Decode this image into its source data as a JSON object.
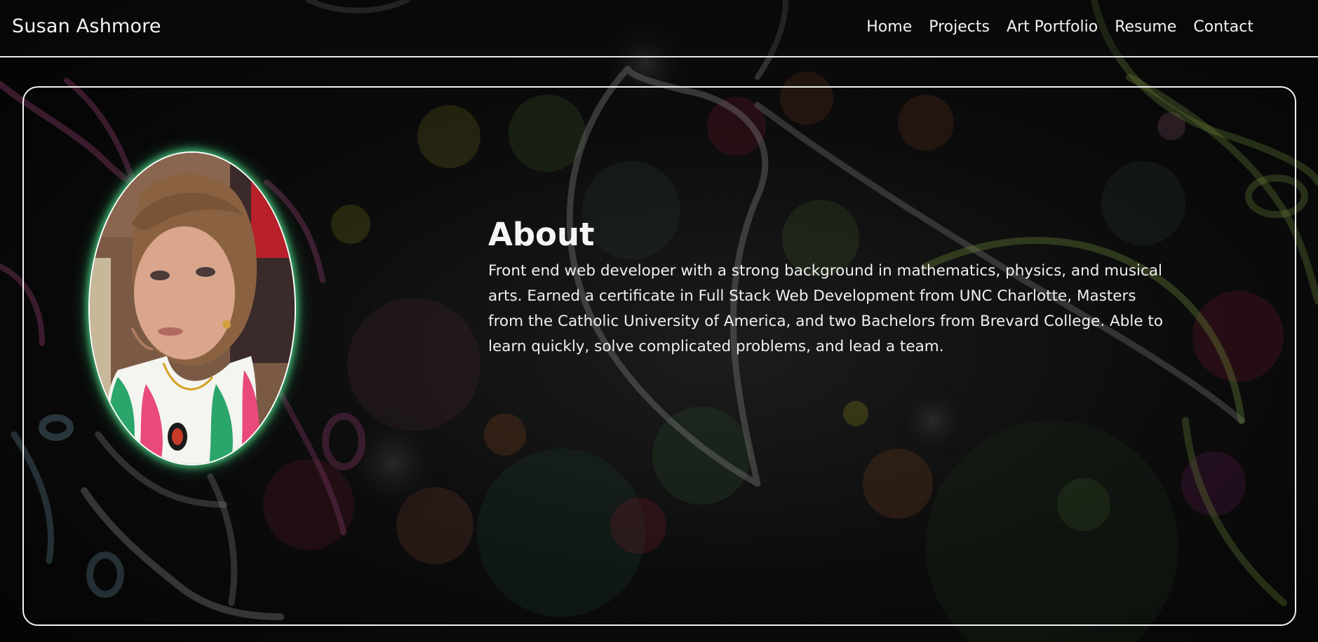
{
  "navbar": {
    "brand": "Susan Ashmore",
    "links": [
      {
        "label": "Home"
      },
      {
        "label": "Projects"
      },
      {
        "label": "Art Portfolio"
      },
      {
        "label": "Resume"
      },
      {
        "label": "Contact"
      }
    ]
  },
  "about": {
    "title": "About",
    "text": "Front end web developer with a strong background in mathematics, physics, and musical arts. Earned a certificate in Full Stack Web Development from UNC Charlotte, Masters from the Catholic University of America, and two Bachelors from Brevard College. Able to learn quickly, solve complicated problems, and lead a team."
  },
  "colors": {
    "accent_glow": "#50dc8c",
    "border": "#f2f2f2",
    "background": "#050505"
  }
}
